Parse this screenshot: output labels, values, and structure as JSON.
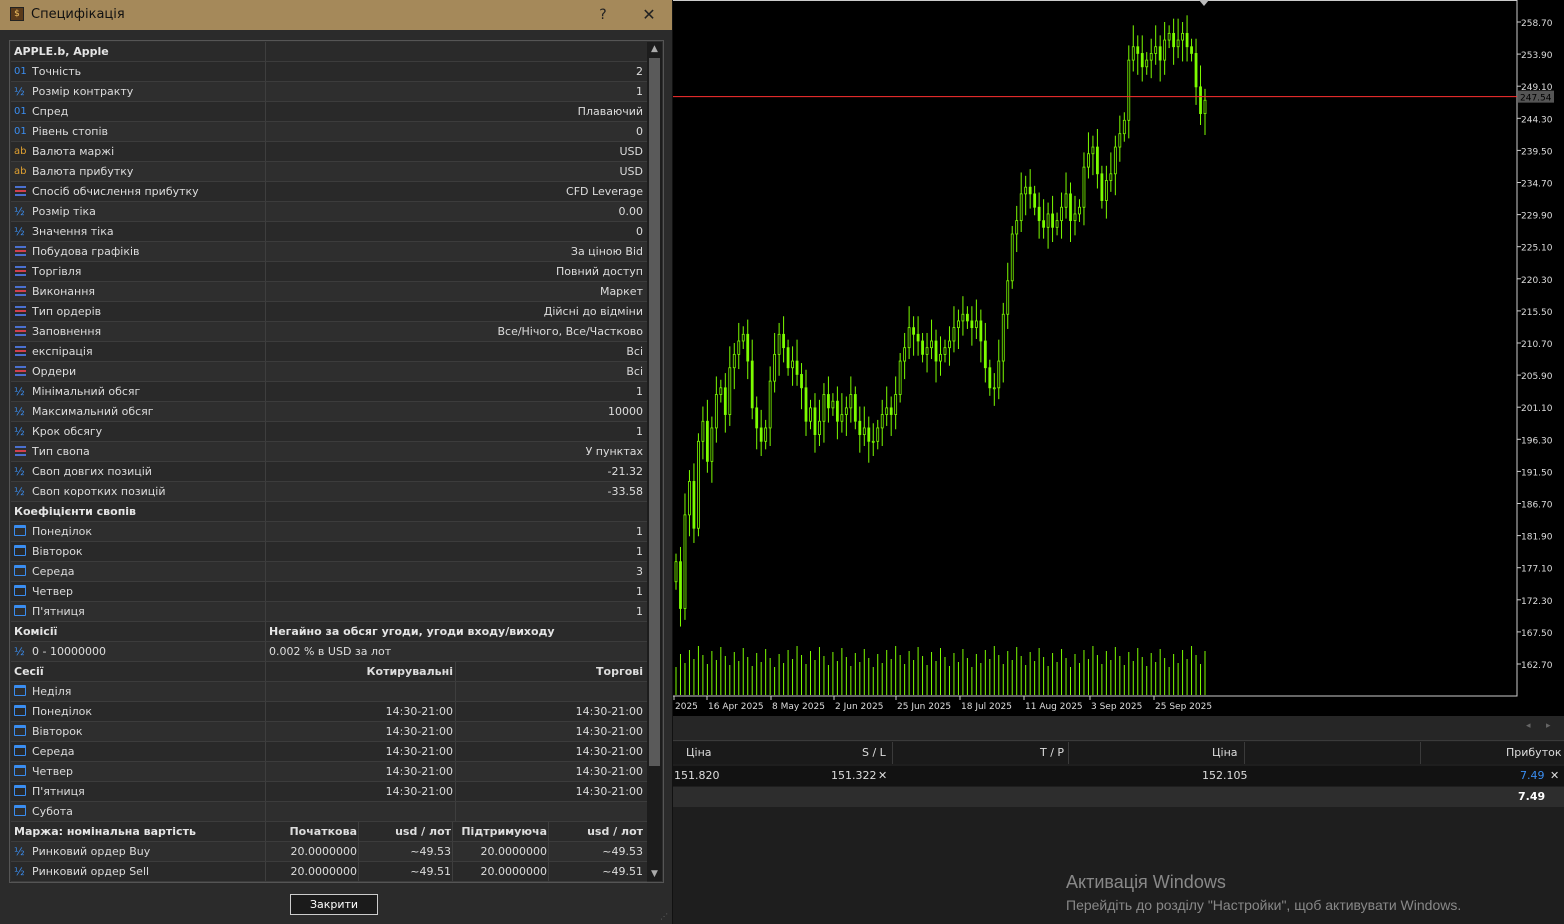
{
  "dialog": {
    "title": "Специфікація",
    "help": "?",
    "close_x": "✕",
    "close_button": "Закрити"
  },
  "spec_rows": [
    {
      "type": "header",
      "label": "APPLE.b, Apple",
      "value": ""
    },
    {
      "icon": "01",
      "label": "Точність",
      "value": "2"
    },
    {
      "icon": "half",
      "label": "Розмір контракту",
      "value": "1"
    },
    {
      "icon": "01",
      "label": "Спред",
      "value": "Плаваючий"
    },
    {
      "icon": "01",
      "label": "Рівень стопів",
      "value": "0"
    },
    {
      "icon": "ab",
      "label": "Валюта маржі",
      "value": "USD"
    },
    {
      "icon": "ab",
      "label": "Валюта прибутку",
      "value": "USD"
    },
    {
      "icon": "list",
      "label": "Спосіб обчислення прибутку",
      "value": "CFD Leverage"
    },
    {
      "icon": "half",
      "label": "Розмір тіка",
      "value": "0.00"
    },
    {
      "icon": "half",
      "label": "Значення тіка",
      "value": "0"
    },
    {
      "icon": "list",
      "label": "Побудова графіків",
      "value": "За ціною Bid"
    },
    {
      "icon": "list",
      "label": "Торгівля",
      "value": "Повний доступ"
    },
    {
      "icon": "list",
      "label": "Виконання",
      "value": "Маркет"
    },
    {
      "icon": "list",
      "label": "Тип ордерів",
      "value": "Дійсні до відміни"
    },
    {
      "icon": "list",
      "label": "Заповнення",
      "value": "Все/Нічого, Все/Частково"
    },
    {
      "icon": "list",
      "label": "експірація",
      "value": "Всі"
    },
    {
      "icon": "list",
      "label": "Ордери",
      "value": "Всі"
    },
    {
      "icon": "half",
      "label": "Мінімальний обсяг",
      "value": "1"
    },
    {
      "icon": "half",
      "label": "Максимальний обсяг",
      "value": "10000"
    },
    {
      "icon": "half",
      "label": "Крок обсягу",
      "value": "1"
    },
    {
      "icon": "list",
      "label": "Тип свопа",
      "value": "У пунктах"
    },
    {
      "icon": "half",
      "label": "Своп довгих позицій",
      "value": "-21.32"
    },
    {
      "icon": "half",
      "label": "Своп коротких позицій",
      "value": "-33.58"
    },
    {
      "type": "header",
      "label": "Коефіцієнти свопів",
      "value": ""
    },
    {
      "icon": "cal",
      "label": "Понеділок",
      "value": "1"
    },
    {
      "icon": "cal",
      "label": "Вівторок",
      "value": "1"
    },
    {
      "icon": "cal",
      "label": "Середа",
      "value": "3"
    },
    {
      "icon": "cal",
      "label": "Четвер",
      "value": "1"
    },
    {
      "icon": "cal",
      "label": "П'ятниця",
      "value": "1"
    }
  ],
  "commissions": {
    "header_label": "Комісії",
    "header_value": "Негайно за обсяг угоди, угоди входу/виходу",
    "row_label": "0 - 10000000",
    "row_value": "0.002 % в USD за лот"
  },
  "sessions": {
    "header": [
      "Сесії",
      "Котирувальні",
      "Торгові"
    ],
    "rows": [
      {
        "day": "Неділя",
        "quote": "",
        "trade": ""
      },
      {
        "day": "Понеділок",
        "quote": "14:30-21:00",
        "trade": "14:30-21:00"
      },
      {
        "day": "Вівторок",
        "quote": "14:30-21:00",
        "trade": "14:30-21:00"
      },
      {
        "day": "Середа",
        "quote": "14:30-21:00",
        "trade": "14:30-21:00"
      },
      {
        "day": "Четвер",
        "quote": "14:30-21:00",
        "trade": "14:30-21:00"
      },
      {
        "day": "П'ятниця",
        "quote": "14:30-21:00",
        "trade": "14:30-21:00"
      },
      {
        "day": "Субота",
        "quote": "",
        "trade": ""
      }
    ]
  },
  "margin": {
    "header": [
      "Маржа: номінальна вартість",
      "Початкова",
      "usd / лот",
      "Підтримуюча",
      "usd / лот"
    ],
    "rows": [
      {
        "label": "Ринковий ордер Buy",
        "c1": "20.0000000",
        "c2": "~49.53",
        "c3": "20.0000000",
        "c4": "~49.53"
      },
      {
        "label": "Ринковий ордер Sell",
        "c1": "20.0000000",
        "c2": "~49.51",
        "c3": "20.0000000",
        "c4": "~49.51"
      }
    ]
  },
  "terminal": {
    "nav_left": "◂",
    "nav_right": "▸",
    "headers": [
      "Ціна",
      "S / L",
      "T / P",
      "Ціна",
      "Прибуток"
    ],
    "row": {
      "price_open": "151.820",
      "sl": "151.322",
      "sl_clear": "✕",
      "price_cur": "152.105",
      "profit": "7.49",
      "close": "✕"
    },
    "total": "7.49"
  },
  "activation": {
    "title": "Активація Windows",
    "subtitle": "Перейдіть до розділу \"Настройки\", щоб активувати Windows."
  },
  "chart_data": {
    "type": "candlestick",
    "y_ticks": [
      "258.70",
      "253.90",
      "249.10",
      "244.30",
      "239.50",
      "234.70",
      "229.90",
      "225.10",
      "220.30",
      "215.50",
      "210.70",
      "205.90",
      "201.10",
      "196.30",
      "191.50",
      "186.70",
      "181.90",
      "177.10",
      "172.30",
      "167.50",
      "162.70"
    ],
    "y_range": [
      162.7,
      258.7
    ],
    "x_ticks": [
      "2025",
      "16 Apr 2025",
      "8 May 2025",
      "2 Jun 2025",
      "25 Jun 2025",
      "18 Jul 2025",
      "11 Aug 2025",
      "3 Sep 2025",
      "25 Sep 2025"
    ],
    "current_price_label": "247.54",
    "current_price": 247.54,
    "bull_color": "#7CFC00",
    "price_line_color": "#ff3030",
    "closes": [
      178,
      171,
      185,
      190,
      183,
      196,
      199,
      193,
      198,
      203,
      204,
      200,
      207,
      209,
      211,
      212,
      208,
      201,
      198,
      196,
      198,
      205,
      209,
      212,
      210,
      207,
      208,
      206,
      204,
      199,
      201,
      197,
      199,
      203,
      201,
      202,
      199,
      200,
      201,
      203,
      199,
      197,
      198,
      196,
      196,
      198,
      200,
      201,
      200,
      203,
      208,
      210,
      213,
      212,
      211,
      209,
      210,
      211,
      208,
      209,
      210,
      211,
      213,
      214,
      215,
      214,
      213,
      214,
      211,
      207,
      204,
      204,
      208,
      215,
      220,
      227,
      229,
      233,
      234,
      233,
      231,
      229,
      228,
      230,
      228,
      229,
      231,
      233,
      229,
      230,
      231,
      237,
      239,
      240,
      236,
      232,
      235,
      236,
      240,
      242,
      244,
      253,
      255,
      254,
      252,
      253,
      254,
      255,
      253,
      256,
      257,
      255,
      256,
      257,
      255,
      254,
      249,
      245,
      247
    ]
  }
}
